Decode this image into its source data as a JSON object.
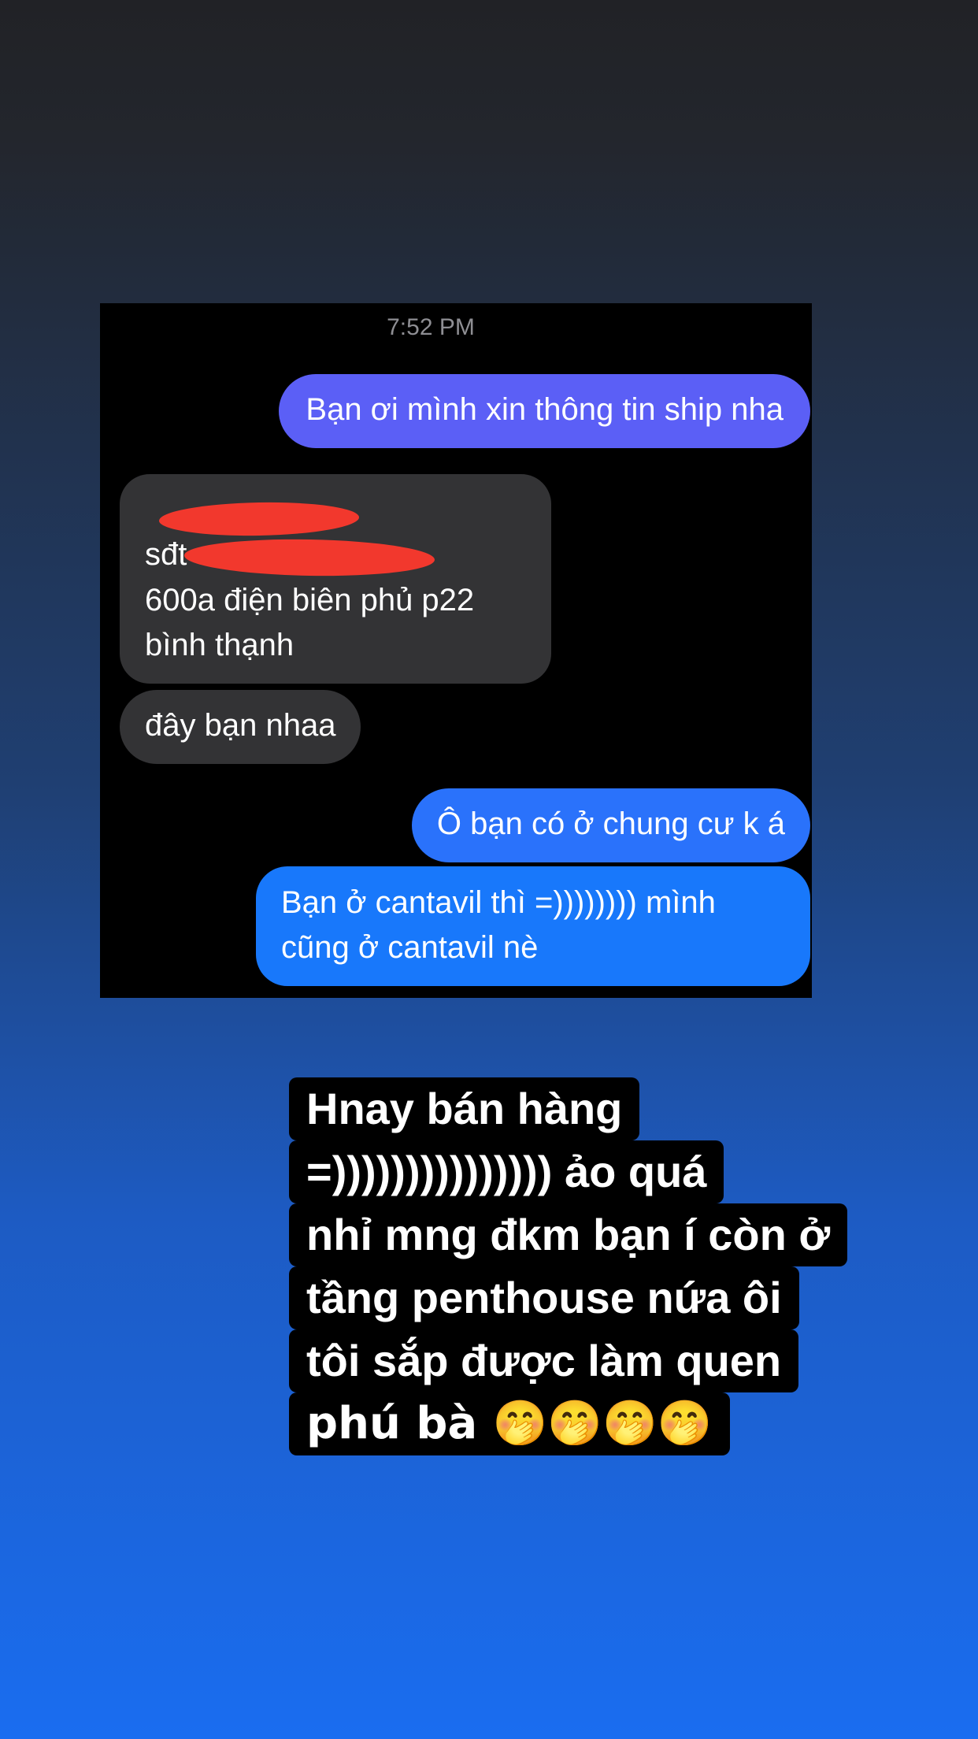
{
  "chat": {
    "timestamp": "7:52 PM",
    "messages": [
      {
        "from": "me",
        "text": "Bạn ơi mình xin thông tin ship nha",
        "color": "#5b5ff6"
      },
      {
        "from": "them",
        "lines": [
          "sđt",
          "600a điện biên phủ p22",
          "bình thạnh"
        ],
        "color": "#333335"
      },
      {
        "from": "them",
        "text": "đây bạn nhaa",
        "color": "#333335"
      },
      {
        "from": "me",
        "text": "Ô bạn có ở chung cư k á",
        "color": "#2a72fb"
      },
      {
        "from": "me",
        "text": "Bạn ở cantavil thì =)))))))) mình cũng ở cantavil nè",
        "color": "#1878fb"
      }
    ],
    "redaction_color": "#f2382d"
  },
  "caption": {
    "lines": [
      "Hnay bán hàng",
      "=))))))))))))))) ảo quá",
      "nhỉ mng đkm bạn í còn ở",
      "tầng penthouse nứa ôi",
      "tôi sắp được làm quen",
      "phú bà 🤭🤭🤭🤭"
    ]
  }
}
